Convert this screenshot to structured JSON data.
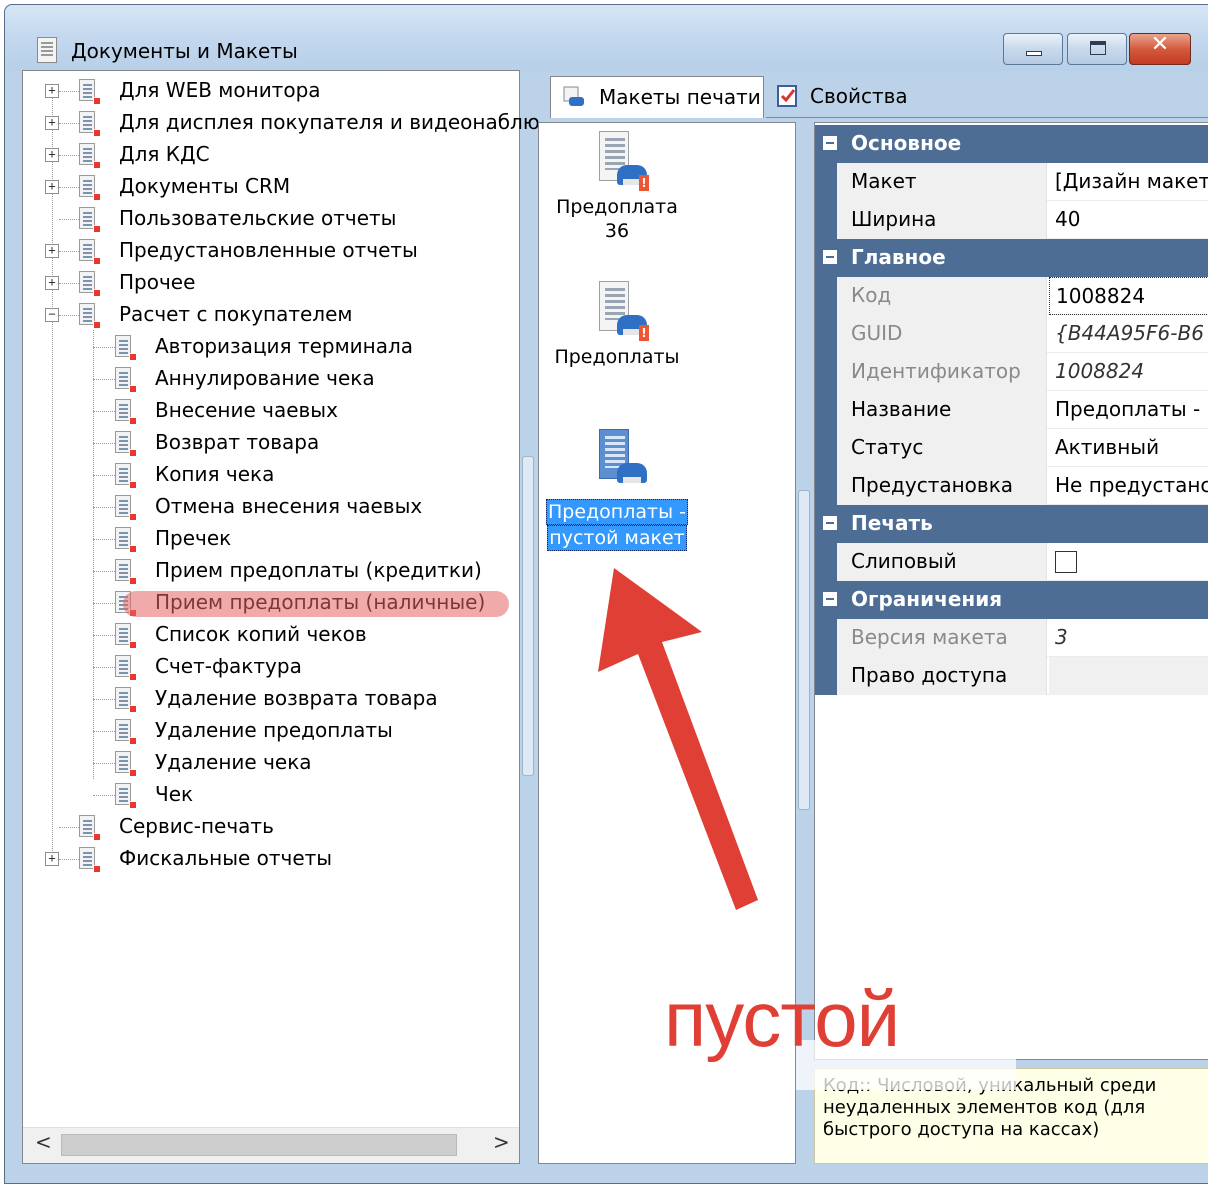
{
  "window": {
    "title": "Документы и Макеты",
    "close_glyph": "✕"
  },
  "tree": {
    "items": [
      {
        "label": "Для WEB монитора",
        "level": 0,
        "expander": "+"
      },
      {
        "label": "Для дисплея покупателя и видеонаблю",
        "level": 0,
        "expander": "+"
      },
      {
        "label": "Для КДС",
        "level": 0,
        "expander": "+"
      },
      {
        "label": "Документы CRM",
        "level": 0,
        "expander": "+"
      },
      {
        "label": "Пользовательские отчеты",
        "level": 0,
        "expander": ""
      },
      {
        "label": "Предустановленные отчеты",
        "level": 0,
        "expander": "+"
      },
      {
        "label": "Прочее",
        "level": 0,
        "expander": "+"
      },
      {
        "label": "Расчет с покупателем",
        "level": 0,
        "expander": "−"
      },
      {
        "label": "Авторизация терминала",
        "level": 1
      },
      {
        "label": "Аннулирование чека",
        "level": 1
      },
      {
        "label": "Внесение чаевых",
        "level": 1
      },
      {
        "label": "Возврат товара",
        "level": 1
      },
      {
        "label": "Копия чека",
        "level": 1
      },
      {
        "label": "Отмена внесения чаевых",
        "level": 1
      },
      {
        "label": "Пречек",
        "level": 1
      },
      {
        "label": "Прием предоплаты (кредитки)",
        "level": 1
      },
      {
        "label": "Прием предоплаты (наличные)",
        "level": 1
      },
      {
        "label": "Список копий чеков",
        "level": 1
      },
      {
        "label": "Счет-фактура",
        "level": 1
      },
      {
        "label": "Удаление возврата товара",
        "level": 1
      },
      {
        "label": "Удаление предоплаты",
        "level": 1
      },
      {
        "label": "Удаление чека",
        "level": 1
      },
      {
        "label": "Чек",
        "level": 1
      },
      {
        "label": "Сервис-печать",
        "level": 0,
        "expander": ""
      },
      {
        "label": "Фискальные отчеты",
        "level": 0,
        "expander": "+"
      }
    ],
    "scroll_left": "<",
    "scroll_right": ">"
  },
  "tabs": {
    "active": "Макеты печати",
    "inactive": "Свойства"
  },
  "layouts": {
    "items": [
      {
        "line1": "Предоплата",
        "line2": "36",
        "selected": false
      },
      {
        "line1": "Предоплаты",
        "line2": "",
        "selected": false
      },
      {
        "line1": "Предоплаты -",
        "line2": "пустой макет",
        "selected": true
      }
    ]
  },
  "properties": {
    "cat_main": "Основное",
    "maket_name": "Макет",
    "maket_value": "[Дизайн макет",
    "width_name": "Ширина",
    "width_value": "40",
    "cat_general": "Главное",
    "code_name": "Код",
    "code_value": "1008824",
    "guid_name": "GUID",
    "guid_value": "{B44A95F6-B6",
    "id_name": "Идентификатор",
    "id_value": "1008824",
    "title_name": "Название",
    "title_value": "Предоплаты -",
    "status_name": "Статус",
    "status_value": "Активный",
    "preset_name": "Предустановка",
    "preset_value": "Не предустанс",
    "cat_print": "Печать",
    "slip_name": "Слиповый",
    "cat_limits": "Ограничения",
    "version_name": "Версия макета",
    "version_value": "3",
    "access_name": "Право доступа",
    "access_value": ""
  },
  "help": {
    "text": "Код:: Числовой, уникальный среди неудаленных элементов код (для быстрого доступа на кассах)"
  },
  "annotation": {
    "text": "пустой",
    "color": "#e03f35"
  }
}
